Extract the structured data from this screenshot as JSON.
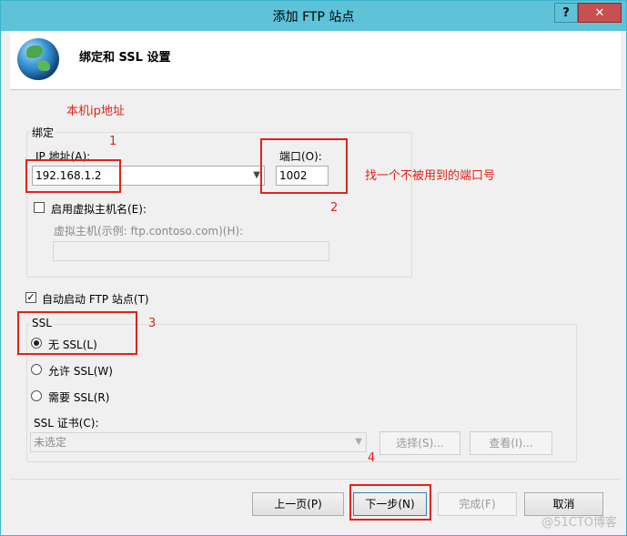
{
  "window": {
    "title": "添加 FTP 站点",
    "help_label": "?",
    "close_label": "✕"
  },
  "header": {
    "title": "绑定和 SSL 设置",
    "icon": "globe-icon"
  },
  "annotations": {
    "local_ip": "本机ip地址",
    "n1": "1",
    "n2": "2",
    "n3": "3",
    "n4": "4",
    "unused_port": "找一个不被用到的端口号",
    "color": "#e0231c"
  },
  "binding": {
    "group_label": "绑定",
    "ip_label": "IP 地址(A):",
    "ip_value": "192.168.1.2",
    "port_label": "端口(O):",
    "port_value": "1002",
    "virtual_host_checkbox": "启用虚拟主机名(E):",
    "virtual_host_checked": false,
    "virtual_host_label": "虚拟主机(示例: ftp.contoso.com)(H):",
    "virtual_host_value": ""
  },
  "autostart": {
    "label": "自动启动 FTP 站点(T)",
    "checked": true
  },
  "ssl": {
    "group_label": "SSL",
    "options": [
      {
        "label": "无 SSL(L)",
        "selected": true
      },
      {
        "label": "允许 SSL(W)",
        "selected": false
      },
      {
        "label": "需要 SSL(R)",
        "selected": false
      }
    ],
    "cert_label": "SSL 证书(C):",
    "cert_value": "未选定",
    "select_button": "选择(S)...",
    "view_button": "查看(I)..."
  },
  "footer": {
    "prev": "上一页(P)",
    "next": "下一步(N)",
    "finish": "完成(F)",
    "cancel": "取消"
  },
  "watermark": "@51CTO博客"
}
